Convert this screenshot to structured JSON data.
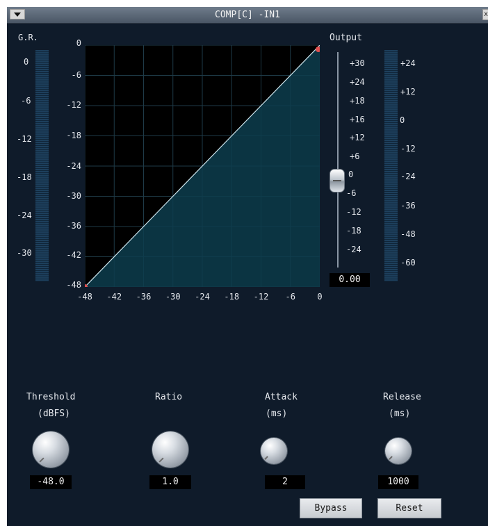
{
  "window": {
    "title": "COMP[C] -IN1",
    "close_label": "x"
  },
  "gr_meter": {
    "label": "G.R.",
    "scale": [
      "0",
      "-6",
      "-12",
      "-18",
      "-24",
      "-30"
    ]
  },
  "transfer_graph": {
    "y_ticks": [
      "0",
      "-6",
      "-12",
      "-18",
      "-24",
      "-30",
      "-36",
      "-42",
      "-48"
    ],
    "x_ticks": [
      "-48",
      "-42",
      "-36",
      "-30",
      "-24",
      "-18",
      "-12",
      "-6",
      "0"
    ],
    "range_db": [
      -48,
      0
    ],
    "curve": [
      [
        -48,
        -48
      ],
      [
        0,
        0
      ]
    ],
    "colors": {
      "background": "#000000",
      "fill": "#0d3d4d",
      "line": "#cfe6ee",
      "grid": "#1e3a47",
      "point": "#e05050"
    }
  },
  "output": {
    "label": "Output",
    "fader_scale": [
      "+30",
      "+24",
      "+18",
      "+16",
      "+12",
      "+6",
      "0",
      "-6",
      "-12",
      "-18",
      "-24"
    ],
    "fader_level_db": 0,
    "value": "0.00",
    "meter_scale": [
      "+24",
      "+12",
      "0",
      "-12",
      "-24",
      "-36",
      "-48",
      "-60"
    ]
  },
  "controls": [
    {
      "id": "threshold",
      "label": "Threshold",
      "unit": "(dBFS)",
      "value": "-48.0"
    },
    {
      "id": "ratio",
      "label": "Ratio",
      "unit": "",
      "value": "1.0"
    },
    {
      "id": "attack",
      "label": "Attack",
      "unit": "(ms)",
      "value": "2"
    },
    {
      "id": "release",
      "label": "Release",
      "unit": "(ms)",
      "value": "1000"
    }
  ],
  "buttons": {
    "bypass": "Bypass",
    "reset": "Reset"
  }
}
